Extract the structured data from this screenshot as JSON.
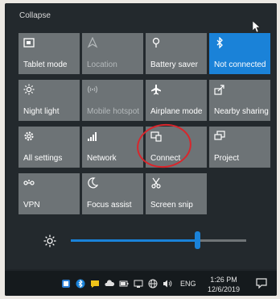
{
  "panel": {
    "collapse_label": "Collapse"
  },
  "tiles": [
    {
      "id": "tablet-mode",
      "label": "Tablet mode",
      "icon": "tablet-mode-icon",
      "state": "off"
    },
    {
      "id": "location",
      "label": "Location",
      "icon": "location-icon",
      "state": "disabled"
    },
    {
      "id": "battery-saver",
      "label": "Battery saver",
      "icon": "battery-saver-icon",
      "state": "off"
    },
    {
      "id": "bluetooth",
      "label": "Not connected",
      "icon": "bluetooth-icon",
      "state": "on"
    },
    {
      "id": "night-light",
      "label": "Night light",
      "icon": "night-light-icon",
      "state": "off"
    },
    {
      "id": "mobile-hotspot",
      "label": "Mobile hotspot",
      "icon": "mobile-hotspot-icon",
      "state": "disabled"
    },
    {
      "id": "airplane-mode",
      "label": "Airplane mode",
      "icon": "airplane-icon",
      "state": "off"
    },
    {
      "id": "nearby-sharing",
      "label": "Nearby sharing",
      "icon": "nearby-sharing-icon",
      "state": "off"
    },
    {
      "id": "all-settings",
      "label": "All settings",
      "icon": "gear-icon",
      "state": "off"
    },
    {
      "id": "network",
      "label": "Network",
      "icon": "network-icon",
      "state": "off"
    },
    {
      "id": "connect",
      "label": "Connect",
      "icon": "connect-icon",
      "state": "off"
    },
    {
      "id": "project",
      "label": "Project",
      "icon": "project-icon",
      "state": "off"
    },
    {
      "id": "vpn",
      "label": "VPN",
      "icon": "vpn-icon",
      "state": "off"
    },
    {
      "id": "focus-assist",
      "label": "Focus assist",
      "icon": "moon-icon",
      "state": "off"
    },
    {
      "id": "screen-snip",
      "label": "Screen snip",
      "icon": "screen-snip-icon",
      "state": "off"
    }
  ],
  "brightness": {
    "icon": "brightness-icon",
    "level": 0.72
  },
  "taskbar": {
    "language": "ENG",
    "time": "1:26 PM",
    "date": "12/6/2019"
  },
  "colors": {
    "accent": "#1a82d8",
    "tile": "#6d7376",
    "panel": "#23292d",
    "annotation": "#d8262c"
  }
}
